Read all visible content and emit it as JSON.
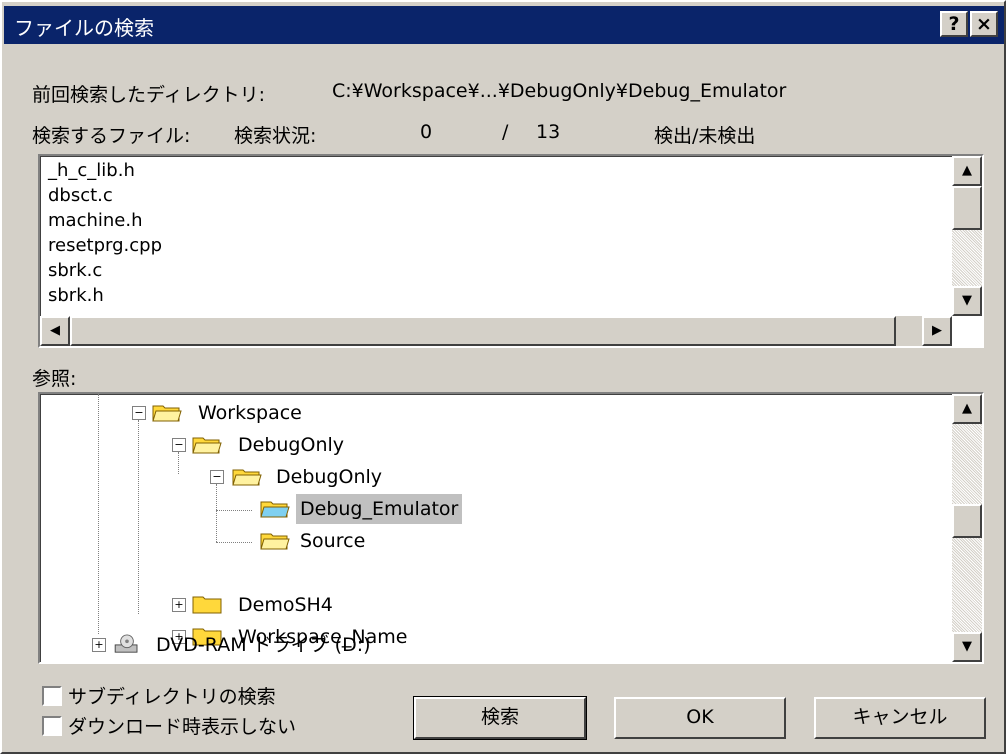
{
  "window": {
    "title": "ファイルの検索",
    "help_label": "?",
    "close_label": "×"
  },
  "header": {
    "prev_dir_label": "前回検索したディレクトリ:",
    "prev_dir_value": "C:¥Workspace¥...¥DebugOnly¥Debug_Emulator",
    "files_label": "検索するファイル:",
    "status_label": "検索状況:",
    "found_count": "0",
    "separator": "/",
    "total_count": "13",
    "status_text": "検出/未検出"
  },
  "files": [
    "_h_c_lib.h",
    "dbsct.c",
    "machine.h",
    "resetprg.cpp",
    "sbrk.c",
    "sbrk.h"
  ],
  "browse_label": "参照:",
  "tree": [
    {
      "label": "Workspace",
      "icon": "folder-open-icon",
      "expander": "−"
    },
    {
      "label": "DebugOnly",
      "icon": "folder-open-icon",
      "expander": "−"
    },
    {
      "label": "DebugOnly",
      "icon": "folder-open-icon",
      "expander": "−"
    },
    {
      "label": "Debug_Emulator",
      "icon": "folder-open-icon",
      "expander": ""
    },
    {
      "label": "Source",
      "icon": "folder-open-icon",
      "expander": ""
    },
    {
      "label": "DemoSH4",
      "icon": "folder-closed-icon",
      "expander": "+"
    },
    {
      "label": "Workspace_Name",
      "icon": "folder-closed-icon",
      "expander": "+"
    },
    {
      "label": "DVD-RAM ドライブ (D:)",
      "icon": "dvd-drive-icon",
      "expander": "+"
    }
  ],
  "options": {
    "subdir_label": "サブディレクトリの検索",
    "no_display_label": "ダウンロード時表示しない"
  },
  "buttons": {
    "search": "検索",
    "ok": "OK",
    "cancel": "キャンセル"
  },
  "colors": {
    "titlebar": "#0a246a",
    "face": "#d4d0c8",
    "selection": "#c0c0c0",
    "folder": "#ffd83b"
  }
}
